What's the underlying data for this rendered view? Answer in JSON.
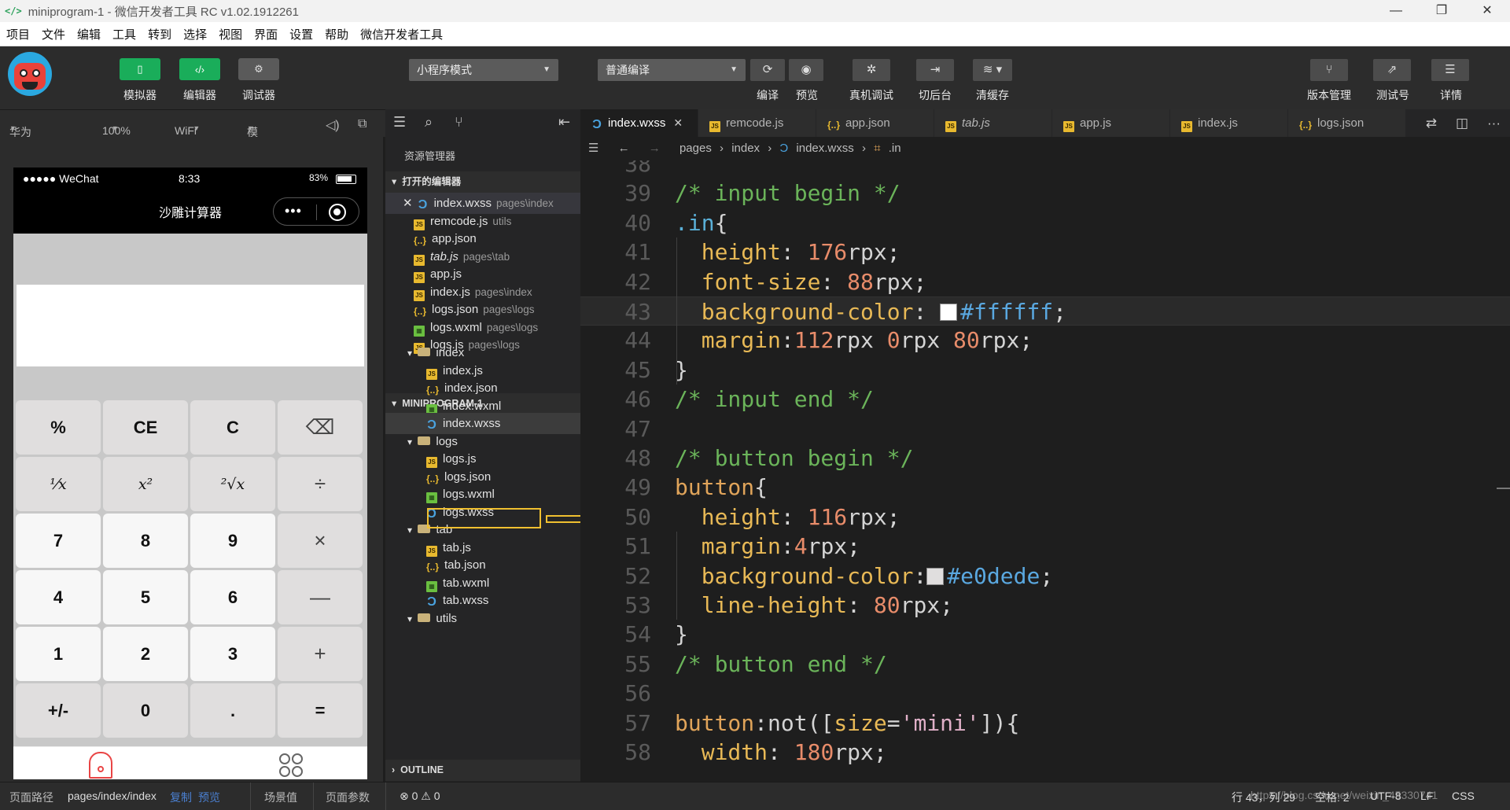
{
  "window": {
    "title": "miniprogram-1 - 微信开发者工具 RC v1.02.1912261",
    "controls": [
      "—",
      "❐",
      "✕"
    ]
  },
  "menu": [
    "项目",
    "文件",
    "编辑",
    "工具",
    "转到",
    "选择",
    "视图",
    "界面",
    "设置",
    "帮助",
    "微信开发者工具"
  ],
  "toolbar": {
    "simulator_label": "模拟器",
    "editor_label": "编辑器",
    "debugger_label": "调试器",
    "mode_select": "小程序模式",
    "compile_select": "普通编译",
    "compile_label": "编译",
    "preview_label": "预览",
    "real_debug_label": "真机调试",
    "background_label": "切后台",
    "clear_cache_label": "清缓存",
    "version_label": "版本管理",
    "test_label": "测试号",
    "details_label": "详情",
    "accent_green": "#1aad5a"
  },
  "simbar": {
    "device": "华为 Mate...",
    "zoom": "100%",
    "network": "WiFi",
    "sim_ops": "模拟操作"
  },
  "phone": {
    "carrier": "●●●●● WeChat",
    "time": "8:33",
    "battery": "83%",
    "nav_title": "沙雕计算器",
    "keys": [
      {
        "label": "%",
        "style": "bold"
      },
      {
        "label": "CE",
        "style": "bold"
      },
      {
        "label": "C",
        "style": "bold"
      },
      {
        "label": "⌫",
        "style": "op"
      },
      {
        "label": "¹⁄x",
        "style": "it"
      },
      {
        "label": "x²",
        "style": "it"
      },
      {
        "label": "²√x",
        "style": "it"
      },
      {
        "label": "÷",
        "style": "op"
      },
      {
        "label": "7",
        "style": "white"
      },
      {
        "label": "8",
        "style": "white"
      },
      {
        "label": "9",
        "style": "white"
      },
      {
        "label": "×",
        "style": "op"
      },
      {
        "label": "4",
        "style": "white"
      },
      {
        "label": "5",
        "style": "white"
      },
      {
        "label": "6",
        "style": "white"
      },
      {
        "label": "—",
        "style": "op"
      },
      {
        "label": "1",
        "style": "white"
      },
      {
        "label": "2",
        "style": "white"
      },
      {
        "label": "3",
        "style": "white"
      },
      {
        "label": "+",
        "style": "op"
      },
      {
        "label": "+/-",
        "style": "bold"
      },
      {
        "label": "0",
        "style": "bold"
      },
      {
        "label": ".",
        "style": "bold"
      },
      {
        "label": "=",
        "style": "bold"
      }
    ]
  },
  "explorer": {
    "title": "资源管理器",
    "open_editors_header": "打开的编辑器",
    "open_editors": [
      {
        "name": "index.wxss",
        "hint": "pages\\index",
        "type": "wxss",
        "close": "✕"
      },
      {
        "name": "remcode.js",
        "hint": "utils",
        "type": "js"
      },
      {
        "name": "app.json",
        "hint": "",
        "type": "json"
      },
      {
        "name": "tab.js",
        "hint": "pages\\tab",
        "type": "js",
        "italic": true
      },
      {
        "name": "app.js",
        "hint": "",
        "type": "js"
      },
      {
        "name": "index.js",
        "hint": "pages\\index",
        "type": "js"
      },
      {
        "name": "logs.json",
        "hint": "pages\\logs",
        "type": "json"
      },
      {
        "name": "logs.wxml",
        "hint": "pages\\logs",
        "type": "wxml"
      },
      {
        "name": "logs.js",
        "hint": "pages\\logs",
        "type": "js"
      }
    ],
    "project_header": "MINIPROGRAM-1",
    "tree": [
      {
        "name": "index",
        "type": "folder",
        "depth": 1
      },
      {
        "name": "index.js",
        "type": "js",
        "depth": 2
      },
      {
        "name": "index.json",
        "type": "json",
        "depth": 2
      },
      {
        "name": "index.wxml",
        "type": "wxml",
        "depth": 2
      },
      {
        "name": "index.wxss",
        "type": "wxss",
        "depth": 2,
        "selected": true
      },
      {
        "name": "logs",
        "type": "folder",
        "depth": 1
      },
      {
        "name": "logs.js",
        "type": "js",
        "depth": 2
      },
      {
        "name": "logs.json",
        "type": "json",
        "depth": 2
      },
      {
        "name": "logs.wxml",
        "type": "wxml",
        "depth": 2
      },
      {
        "name": "logs.wxss",
        "type": "wxss",
        "depth": 2
      },
      {
        "name": "tab",
        "type": "folder",
        "depth": 1
      },
      {
        "name": "tab.js",
        "type": "js",
        "depth": 2
      },
      {
        "name": "tab.json",
        "type": "json",
        "depth": 2
      },
      {
        "name": "tab.wxml",
        "type": "wxml",
        "depth": 2
      },
      {
        "name": "tab.wxss",
        "type": "wxss",
        "depth": 2
      },
      {
        "name": "utils",
        "type": "folder",
        "depth": 1
      }
    ],
    "outline_header": "OUTLINE"
  },
  "tabs": [
    {
      "name": "index.wxss",
      "type": "wxss",
      "active": true,
      "close": "✕"
    },
    {
      "name": "remcode.js",
      "type": "js"
    },
    {
      "name": "app.json",
      "type": "json"
    },
    {
      "name": "tab.js",
      "type": "js",
      "italic": true
    },
    {
      "name": "app.js",
      "type": "js"
    },
    {
      "name": "index.js",
      "type": "js"
    },
    {
      "name": "logs.json",
      "type": "json"
    }
  ],
  "breadcrumb": {
    "segments": [
      "pages",
      "index",
      "index.wxss",
      ".in"
    ]
  },
  "code": [
    {
      "ln": "38",
      "html": ""
    },
    {
      "ln": "39",
      "tokens": [
        [
          "c-comment",
          "/* input begin */"
        ]
      ]
    },
    {
      "ln": "40",
      "tokens": [
        [
          "c-cls",
          ".in"
        ],
        [
          "",
          "{"
        ]
      ]
    },
    {
      "ln": "41",
      "tokens": [
        [
          "",
          "  "
        ],
        [
          "c-prop",
          "height"
        ],
        [
          "",
          ": "
        ],
        [
          "c-num",
          "176"
        ],
        [
          "",
          "rpx;"
        ]
      ]
    },
    {
      "ln": "42",
      "tokens": [
        [
          "",
          "  "
        ],
        [
          "c-prop",
          "font-size"
        ],
        [
          "",
          ": "
        ],
        [
          "c-num",
          "88"
        ],
        [
          "",
          "rpx;"
        ]
      ]
    },
    {
      "ln": "43",
      "tokens": [
        [
          "",
          "  "
        ],
        [
          "c-prop",
          "background-color"
        ],
        [
          "",
          ": "
        ],
        [
          "swatch",
          "#ffffff"
        ],
        [
          "c-hex",
          "#ffffff"
        ],
        [
          "",
          ";"
        ]
      ],
      "current": true
    },
    {
      "ln": "44",
      "tokens": [
        [
          "",
          "  "
        ],
        [
          "c-prop",
          "margin"
        ],
        [
          "",
          ":"
        ],
        [
          "c-num",
          "112"
        ],
        [
          "",
          "rpx "
        ],
        [
          "c-num",
          "0"
        ],
        [
          "",
          "rpx "
        ],
        [
          "c-num",
          "80"
        ],
        [
          "",
          "rpx;"
        ]
      ]
    },
    {
      "ln": "45",
      "tokens": [
        [
          "",
          "}"
        ]
      ]
    },
    {
      "ln": "46",
      "tokens": [
        [
          "c-comment",
          "/* input end */"
        ]
      ]
    },
    {
      "ln": "47",
      "tokens": []
    },
    {
      "ln": "48",
      "tokens": [
        [
          "c-comment",
          "/* button begin */"
        ]
      ]
    },
    {
      "ln": "49",
      "tokens": [
        [
          "c-sel",
          "button"
        ],
        [
          "",
          "{"
        ]
      ]
    },
    {
      "ln": "50",
      "tokens": [
        [
          "",
          "  "
        ],
        [
          "c-prop",
          "height"
        ],
        [
          "",
          ": "
        ],
        [
          "c-num",
          "116"
        ],
        [
          "",
          "rpx;"
        ]
      ]
    },
    {
      "ln": "51",
      "tokens": [
        [
          "",
          "  "
        ],
        [
          "c-prop",
          "margin"
        ],
        [
          "",
          ":"
        ],
        [
          "c-num",
          "4"
        ],
        [
          "",
          "rpx;"
        ]
      ]
    },
    {
      "ln": "52",
      "tokens": [
        [
          "",
          "  "
        ],
        [
          "c-prop",
          "background-color"
        ],
        [
          "",
          ":"
        ],
        [
          "swatch",
          "#e0dede"
        ],
        [
          "c-hex",
          "#e0dede"
        ],
        [
          "",
          ";"
        ]
      ]
    },
    {
      "ln": "53",
      "tokens": [
        [
          "",
          "  "
        ],
        [
          "c-prop",
          "line-height"
        ],
        [
          "",
          ": "
        ],
        [
          "c-num",
          "80"
        ],
        [
          "",
          "rpx;"
        ]
      ]
    },
    {
      "ln": "54",
      "tokens": [
        [
          "",
          "}"
        ]
      ]
    },
    {
      "ln": "55",
      "tokens": [
        [
          "c-comment",
          "/* button end */"
        ]
      ]
    },
    {
      "ln": "56",
      "tokens": []
    },
    {
      "ln": "57",
      "tokens": [
        [
          "c-sel",
          "button"
        ],
        [
          "",
          ":not(["
        ],
        [
          "c-prop",
          "size"
        ],
        [
          "",
          "="
        ],
        [
          "c-str",
          "'mini'"
        ],
        [
          "",
          "]){"
        ]
      ]
    },
    {
      "ln": "58",
      "tokens": [
        [
          "",
          "  "
        ],
        [
          "c-prop",
          "width"
        ],
        [
          "",
          ": "
        ],
        [
          "c-num",
          "180"
        ],
        [
          "",
          "rpx;"
        ]
      ]
    }
  ],
  "statusbar": {
    "path_label": "页面路径",
    "path": "pages/index/index",
    "copy": "复制",
    "preview": "预览",
    "scene": "场景值",
    "params": "页面参数",
    "errors": "⊗ 0 ⚠ 0",
    "position": "行 43，列 29",
    "spaces": "空格: 2",
    "encoding": "UTF-8",
    "eol": "LF",
    "lang": "CSS",
    "watermark": "https://blog.csdn.net/weixin_45330741"
  }
}
